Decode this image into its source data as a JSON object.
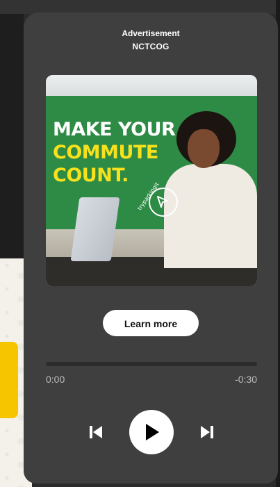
{
  "ad": {
    "label": "Advertisement",
    "sponsor": "NCTCOG"
  },
  "artwork": {
    "headline_line1": "MAKE YOUR",
    "headline_line2": "COMMUTE",
    "headline_line3": "COUNT.",
    "badge_text": "tryparkingit",
    "colors": {
      "green": "#2e8b45",
      "yellow": "#f6e11c"
    }
  },
  "cta": {
    "label": "Learn more"
  },
  "playback": {
    "elapsed": "0:00",
    "remaining": "-0:30",
    "progress_fraction": 0.0
  },
  "controls": {
    "previous_icon": "skip-previous-icon",
    "play_icon": "play-icon",
    "next_icon": "skip-next-icon"
  },
  "colors": {
    "card": "#3f3f3f",
    "accent_tab": "#f6c500"
  }
}
